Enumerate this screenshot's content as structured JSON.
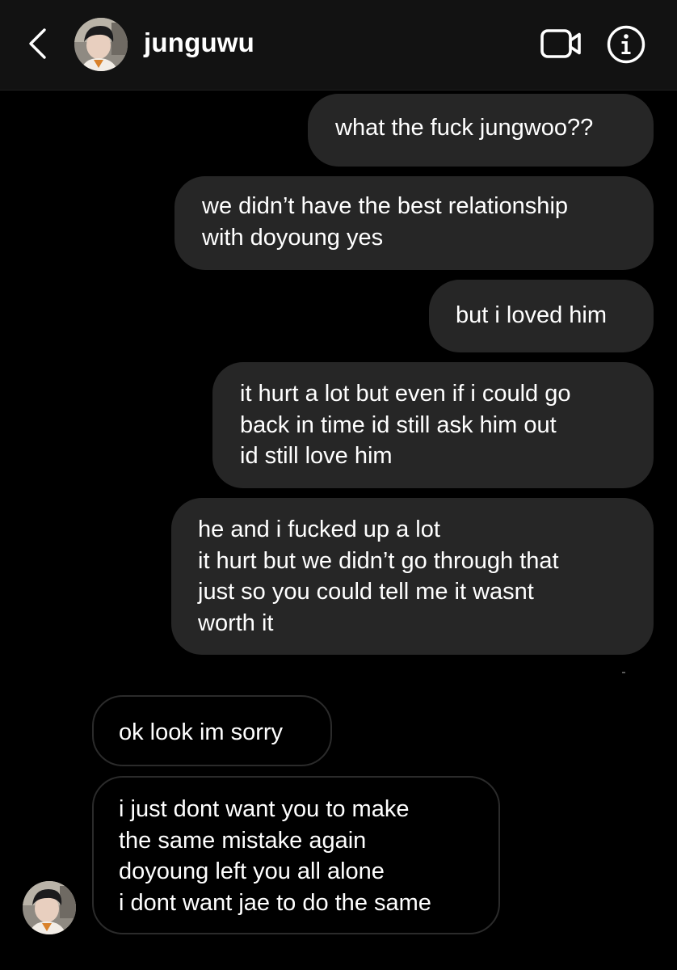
{
  "header": {
    "username": "junguwu",
    "back_icon": "chevron-left-icon",
    "video_icon": "video-camera-icon",
    "info_icon": "info-icon"
  },
  "colors": {
    "background": "#000000",
    "header_background": "#121212",
    "sent_bubble": "#262626",
    "received_bubble_border": "#2b2b2b",
    "text": "#ffffff"
  },
  "messages": [
    {
      "direction": "sent",
      "text": "what the fuck jungwoo??"
    },
    {
      "direction": "sent",
      "text": "we didn’t have the best relationship\nwith doyoung yes"
    },
    {
      "direction": "sent",
      "text": "but i loved him"
    },
    {
      "direction": "sent",
      "text": "it hurt a lot but even if i could go\nback in time id still ask him out\nid still love him"
    },
    {
      "direction": "sent",
      "text": "he and i fucked up a lot\nit hurt but we didn’t go through that\njust so you could tell me it wasnt\nworth it"
    },
    {
      "direction": "received",
      "text": "ok look im sorry"
    },
    {
      "direction": "received",
      "text": "i just dont want you to make\nthe same mistake again\ndoyoung left you all alone\ni dont want jae to do the same"
    }
  ]
}
